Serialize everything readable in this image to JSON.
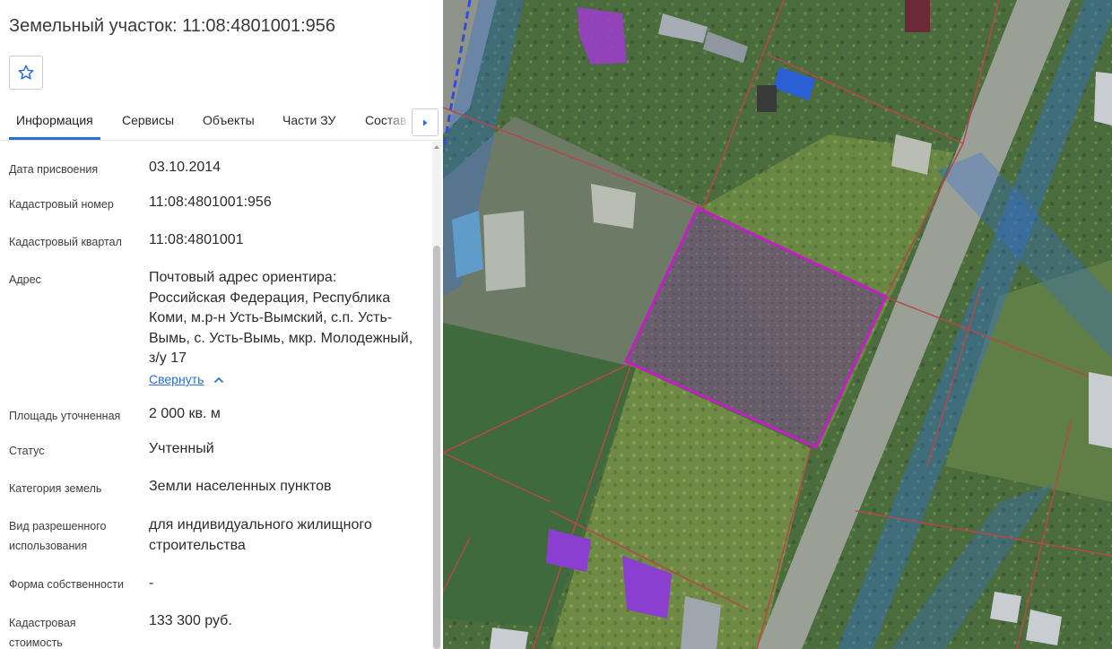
{
  "panel": {
    "title": "Земельный участок: 11:08:4801001:956",
    "favorite_icon": "star-icon",
    "tabs": [
      {
        "label": "Информация",
        "active": true
      },
      {
        "label": "Сервисы"
      },
      {
        "label": "Объекты"
      },
      {
        "label": "Части ЗУ"
      },
      {
        "label": "Состав"
      }
    ],
    "tab_next_icon": "caret-right-icon",
    "fields": [
      {
        "label": "Дата присвоения",
        "value": "03.10.2014"
      },
      {
        "label": "Кадастровый номер",
        "value": "11:08:4801001:956"
      },
      {
        "label": "Кадастровый квартал",
        "value": "11:08:4801001"
      },
      {
        "label": "Адрес",
        "value": "Почтовый адрес ориентира: Российская Федерация, Республика Коми, м.р-н Усть-Вымский, с.п. Усть-Вымь, с. Усть-Вымь, мкр. Молодежный, з/у 17",
        "link": "Свернуть"
      },
      {
        "label": "Площадь уточненная",
        "value": "2 000 кв. м"
      },
      {
        "label": "Статус",
        "value": "Учтенный"
      },
      {
        "label": "Категория земель",
        "value": "Земли населенных пунктов"
      },
      {
        "label": "Вид разрешенного использования",
        "value": "для индивидуального жилищного строительства"
      },
      {
        "label": "Форма собственности",
        "value": "-"
      },
      {
        "label": "Кадастровая стоимость",
        "value": "133 300 руб."
      }
    ]
  },
  "map": {
    "view": "satellite",
    "selected_parcel_color": "#c21fc4",
    "parcel_border_color": "#b5484a",
    "zone_color": "#2f6ee0",
    "roof_purple": "#9a3fc4"
  }
}
